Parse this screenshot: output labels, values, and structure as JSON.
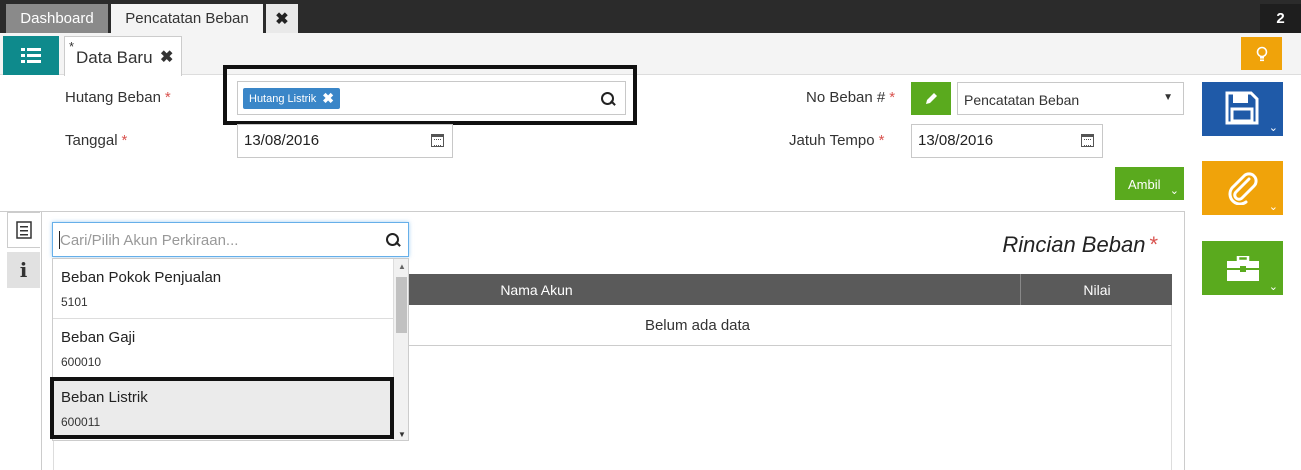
{
  "topbar": {
    "tabs": [
      {
        "label": "Dashboard"
      },
      {
        "label": "Pencatatan Beban"
      }
    ],
    "close_label": "✖",
    "window_count": "2"
  },
  "subbar": {
    "tab_modified_marker": "*",
    "tab_label": "Data Baru",
    "tab_close": "✖"
  },
  "form": {
    "hutang_beban": {
      "label": "Hutang Beban",
      "required": "*",
      "chip": "Hutang Listrik",
      "chip_remove": "✖"
    },
    "tanggal": {
      "label": "Tanggal",
      "required": "*",
      "value": "13/08/2016"
    },
    "no_beban": {
      "label": "No Beban #",
      "required": "*",
      "selected": "Pencatatan Beban"
    },
    "jatuh_tempo": {
      "label": "Jatuh Tempo",
      "required": "*",
      "value": "13/08/2016"
    },
    "ambil_label": "Ambil"
  },
  "details": {
    "title": "Rincian Beban",
    "required": "*",
    "columns": [
      "Nama Akun",
      "Nilai"
    ],
    "empty_text": "Belum ada data"
  },
  "account_dropdown": {
    "placeholder": "Cari/Pilih Akun Perkiraan...",
    "items": [
      {
        "name": "Beban Pokok Penjualan",
        "code": "5101"
      },
      {
        "name": "Beban Gaji",
        "code": "600010"
      },
      {
        "name": "Beban Listrik",
        "code": "600011"
      }
    ]
  },
  "icons": {
    "list": "list-icon",
    "bulb": "lightbulb-icon",
    "save": "floppy-disk-icon",
    "attach": "paperclip-icon",
    "briefcase": "briefcase-icon",
    "pencil": "pencil-icon",
    "calendar": "calendar-icon",
    "search": "search-icon",
    "info": "info-icon",
    "doc": "document-icon"
  },
  "colors": {
    "teal": "#0e8a8c",
    "save_blue": "#1f5aa8",
    "orange": "#f0a30a",
    "green": "#5aaa1e",
    "chip_blue": "#3a86c8",
    "required_red": "#d9534f",
    "table_header": "#5a5a5a"
  }
}
